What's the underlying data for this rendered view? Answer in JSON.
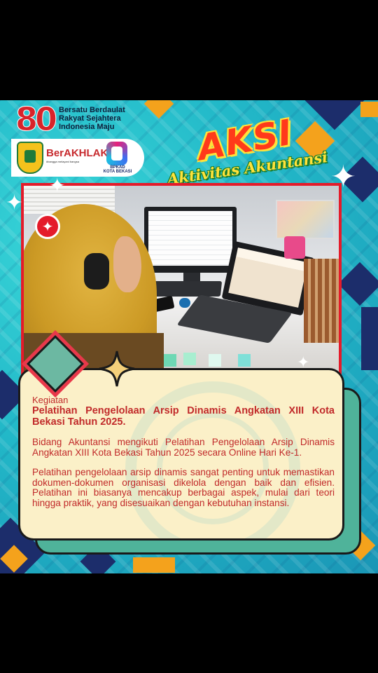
{
  "header": {
    "anniversary_mark": "80",
    "tagline": [
      "Bersatu Berdaulat",
      "Rakyat Sejahtera",
      "Indonesia Maju"
    ],
    "berakhlak_label": "BerAKHLAK",
    "berakhlak_sub": "#bangga melayani bangsa",
    "bpkad_label": "BPKAD",
    "bpkad_sub": "KOTA BEKASI"
  },
  "campaign": {
    "title": "AKSI",
    "subtitle": "Aktivitas Akuntansi"
  },
  "card": {
    "category": "Kegiatan",
    "headline": "Pelatihan Pengelolaan Arsip Dinamis Angkatan XIII Kota Bekasi Tahun 2025.",
    "paragraph1": "Bidang Akuntansi mengikuti Pelatihan Pengelolaan Arsip Dinamis Angkatan XIII Kota Bekasi Tahun 2025 secara Online Hari Ke-1.",
    "paragraph2": "Pelatihan pengelolaan arsip dinamis sangat penting untuk memastikan dokumen-dokumen organisasi dikelola dengan baik dan efisien. Pelatihan ini biasanya mencakup berbagai aspek, mulai dari teori hingga praktik, yang disesuaikan dengan kebutuhan instansi."
  },
  "colors": {
    "background_teal": "#22b8c8",
    "accent_red": "#e41b2a",
    "accent_orange": "#f4a21c",
    "navy": "#1c2d6b",
    "card_cream": "#fbf0c8",
    "card_shadow_green": "#4fb39a",
    "text_red": "#c12a2a"
  }
}
